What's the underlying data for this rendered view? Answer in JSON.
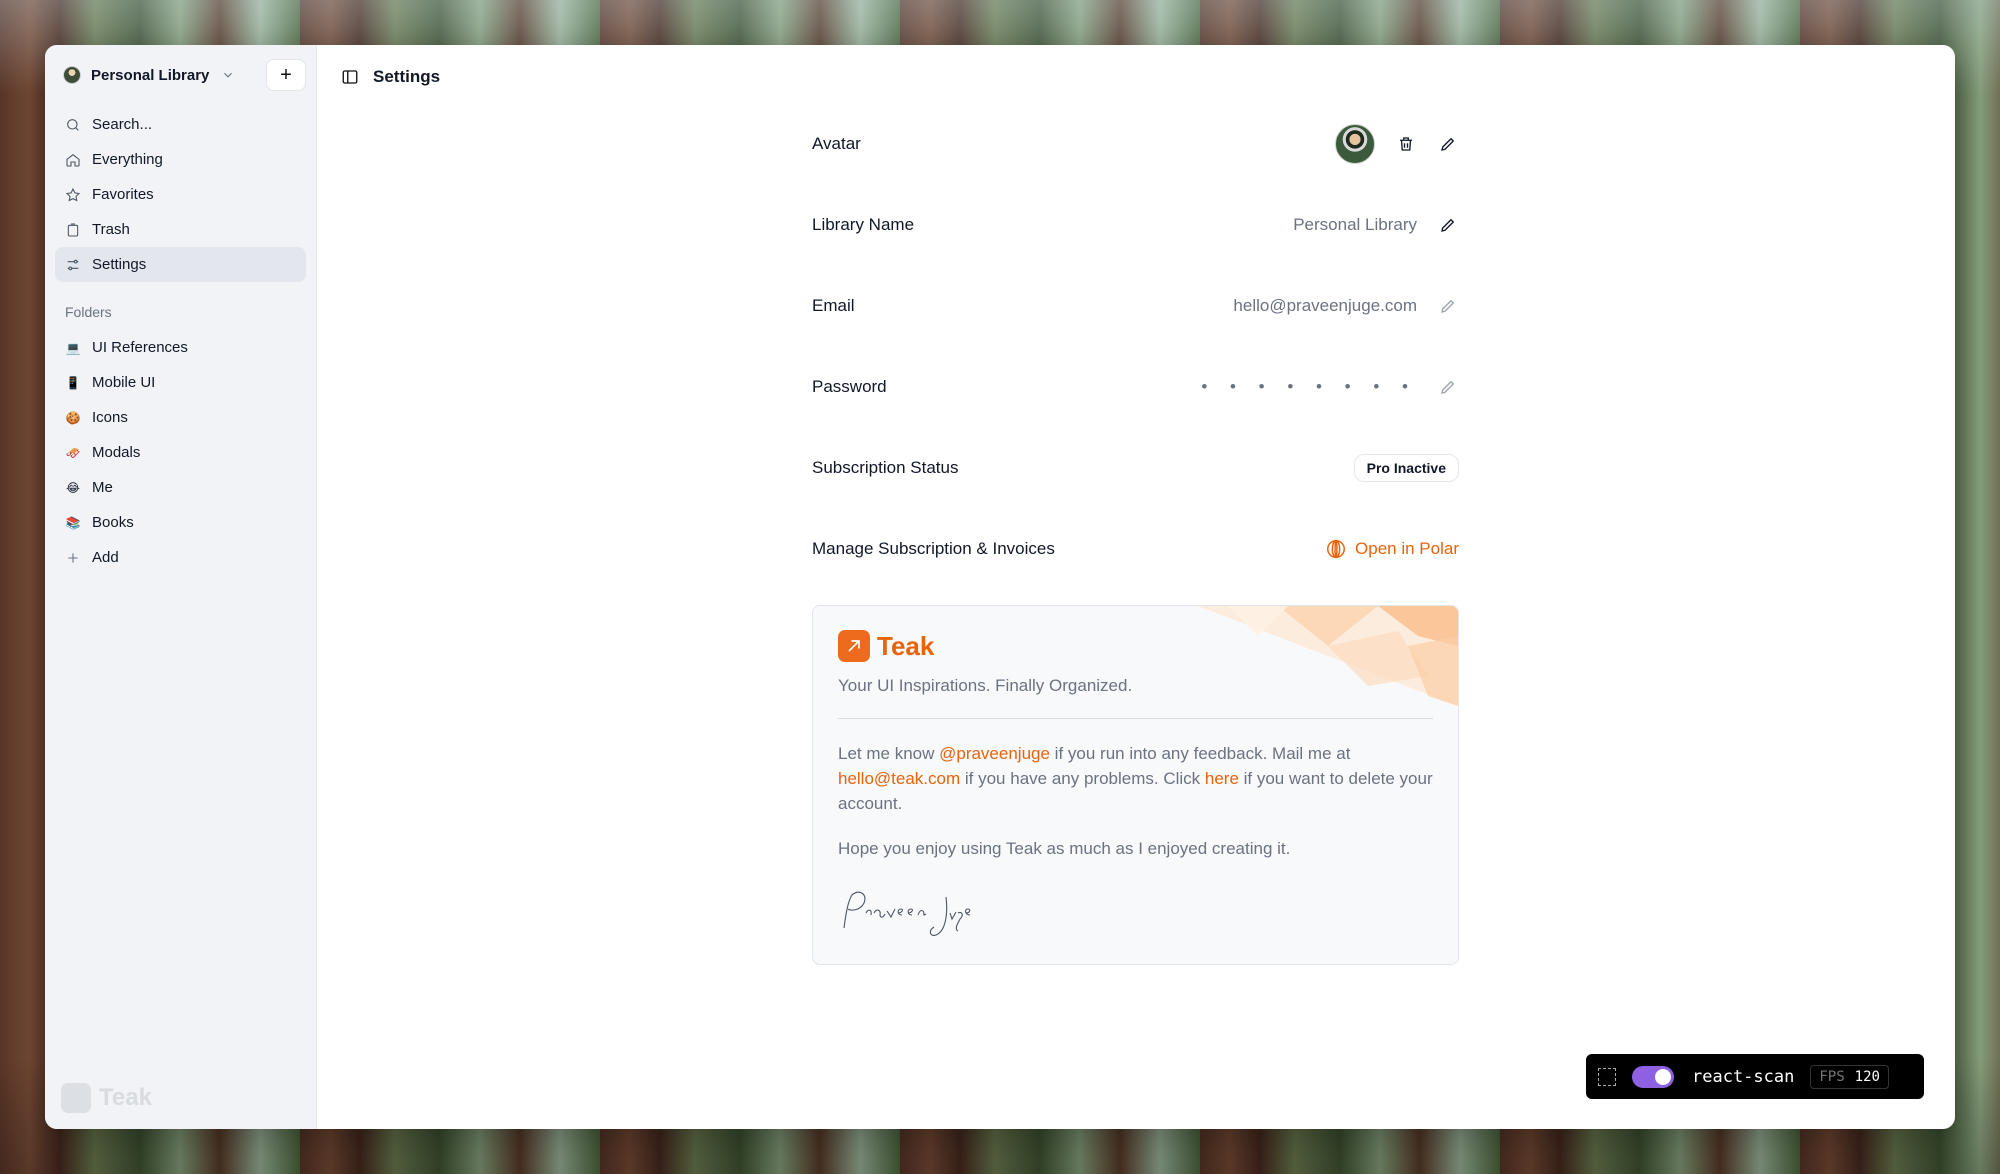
{
  "sidebar": {
    "library_name": "Personal Library",
    "add_label": "+",
    "nav": [
      {
        "label": "Search...",
        "icon": "search-icon"
      },
      {
        "label": "Everything",
        "icon": "home-icon"
      },
      {
        "label": "Favorites",
        "icon": "star-icon"
      },
      {
        "label": "Trash",
        "icon": "trash-icon"
      },
      {
        "label": "Settings",
        "icon": "settings-icon",
        "active": true
      }
    ],
    "folders_title": "Folders",
    "folders": [
      {
        "label": "UI References",
        "emoji": "💻"
      },
      {
        "label": "Mobile UI",
        "emoji": "📱"
      },
      {
        "label": "Icons",
        "emoji": "🍪"
      },
      {
        "label": "Modals",
        "emoji": "🛷"
      },
      {
        "label": "Me",
        "emoji": "😂"
      },
      {
        "label": "Books",
        "emoji": "📚"
      }
    ],
    "add_folder_label": "Add",
    "logo_text": "Teak"
  },
  "header": {
    "title": "Settings"
  },
  "settings": {
    "avatar_label": "Avatar",
    "library_name_label": "Library Name",
    "library_name_value": "Personal Library",
    "email_label": "Email",
    "email_value": "hello@praveenjuge.com",
    "password_label": "Password",
    "password_value": "• • • • • • • •",
    "subscription_label": "Subscription Status",
    "subscription_value": "Pro Inactive",
    "manage_label": "Manage Subscription & Invoices",
    "manage_link": "Open in Polar"
  },
  "card": {
    "brand": "Teak",
    "tagline": "Your UI Inspirations. Finally Organized.",
    "p1_a": "Let me know ",
    "p1_handle": "@praveenjuge",
    "p1_b": " if you run into any feedback. Mail me at ",
    "p1_email": "hello@teak.com",
    "p1_c": " if you have any problems. Click ",
    "p1_here": "here",
    "p1_d": " if you want to delete your account.",
    "p2": "Hope you enjoy using Teak as much as I enjoyed creating it.",
    "signature": "Praveen Juge"
  },
  "react_scan": {
    "label": "react-scan",
    "fps_key": "FPS",
    "fps_value": "120",
    "enabled": true
  },
  "colors": {
    "accent": "#e8630a",
    "sidebar_bg": "#f1f3f6",
    "toggle": "#8e61e3"
  }
}
